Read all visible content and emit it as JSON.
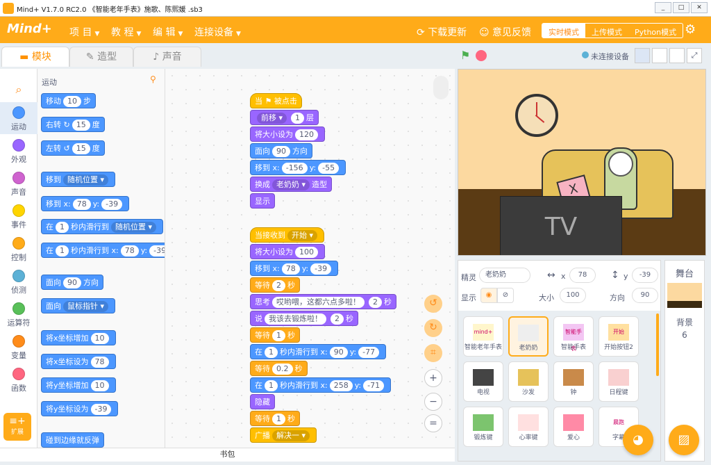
{
  "window": {
    "title": "Mind+ V1.7.0 RC2.0   《智能老年手表》施歌、陈熙媛 .sb3",
    "controls": [
      "_",
      "□",
      "✕"
    ]
  },
  "menubar": {
    "brand": "Mind+",
    "items": [
      "项 目",
      "教 程",
      "编 辑",
      "连接设备"
    ],
    "download": "下载更新",
    "feedback": "意见反馈",
    "modes": [
      "实时模式",
      "上传模式",
      "Python模式"
    ]
  },
  "tabs": {
    "blocks": "模块",
    "costumes": "造型",
    "sounds": "声音"
  },
  "categories": [
    {
      "label": "运动",
      "color": "#4c97ff"
    },
    {
      "label": "外观",
      "color": "#9966ff"
    },
    {
      "label": "声音",
      "color": "#cf63cf"
    },
    {
      "label": "事件",
      "color": "#ffd500"
    },
    {
      "label": "控制",
      "color": "#ffab19"
    },
    {
      "label": "侦测",
      "color": "#5cb1d6"
    },
    {
      "label": "运算符",
      "color": "#59c059"
    },
    {
      "label": "变量",
      "color": "#ff8c1a"
    },
    {
      "label": "函数",
      "color": "#ff6680"
    }
  ],
  "extension": "扩展",
  "palette": {
    "section": "运动",
    "move": {
      "a": "移动",
      "v": "10",
      "b": "步"
    },
    "turn_right": {
      "a": "右转 ↻",
      "v": "15",
      "b": "度"
    },
    "turn_left": {
      "a": "左转 ↺",
      "v": "15",
      "b": "度"
    },
    "goto": {
      "a": "移到",
      "dd": "随机位置 ▾"
    },
    "goto_xy": {
      "a": "移到 x:",
      "x": "78",
      "b": "y:",
      "y": "-39"
    },
    "glide": {
      "a": "在",
      "v": "1",
      "b": "秒内滑行到",
      "dd": "随机位置 ▾"
    },
    "glide_xy": {
      "a": "在",
      "v": "1",
      "b": "秒内滑行到 x:",
      "x": "78",
      "c": "y:",
      "y": "-39"
    },
    "point": {
      "a": "面向",
      "v": "90",
      "b": "方向"
    },
    "point_to": {
      "a": "面向",
      "dd": "鼠标指针 ▾"
    },
    "change_x": {
      "a": "将x坐标增加",
      "v": "10"
    },
    "set_x": {
      "a": "将x坐标设为",
      "v": "78"
    },
    "change_y": {
      "a": "将y坐标增加",
      "v": "10"
    },
    "set_y": {
      "a": "将y坐标设为",
      "v": "-39"
    },
    "bounce": "碰到边缘就反弹"
  },
  "script1": {
    "hat": "当 ⚑ 被点击",
    "layer": {
      "dd": "前移 ▾",
      "v": "1",
      "b": "层"
    },
    "size": {
      "a": "将大小设为",
      "v": "120"
    },
    "dir": {
      "a": "面向",
      "v": "90",
      "b": "方向"
    },
    "pos": {
      "a": "移到 x:",
      "x": "-156",
      "b": "y:",
      "y": "-55"
    },
    "costume": {
      "a": "换成",
      "dd": "老奶奶 ▾",
      "b": "造型"
    },
    "show": "显示"
  },
  "script2": {
    "hat": {
      "a": "当接收到",
      "dd": "开始 ▾"
    },
    "size": {
      "a": "将大小设为",
      "v": "100"
    },
    "pos": {
      "a": "移到 x:",
      "x": "78",
      "b": "y:",
      "y": "-39"
    },
    "wait1": {
      "a": "等待",
      "v": "2",
      "b": "秒"
    },
    "think": {
      "a": "思考",
      "t": "哎哟喂，这都六点多啦！",
      "v": "2",
      "b": "秒"
    },
    "say": {
      "a": "说",
      "t": "我该去锻炼啦！",
      "v": "2",
      "b": "秒"
    },
    "wait2": {
      "a": "等待",
      "v": "1",
      "b": "秒"
    },
    "glide1": {
      "a": "在",
      "v": "1",
      "b": "秒内滑行到 x:",
      "x": "90",
      "c": "y:",
      "y": "-77"
    },
    "wait3": {
      "a": "等待",
      "v": "0.2",
      "b": "秒"
    },
    "glide2": {
      "a": "在",
      "v": "1",
      "b": "秒内滑行到 x:",
      "x": "258",
      "c": "y:",
      "y": "-71"
    },
    "hide": "隐藏",
    "wait4": {
      "a": "等待",
      "v": "1",
      "b": "秒"
    },
    "broadcast": {
      "a": "广播",
      "dd": "解决一 ▾"
    }
  },
  "bookbar": "书包",
  "stagehead": {
    "status": "未连接设备"
  },
  "stage": {
    "tv_text": "TV"
  },
  "sprite": {
    "label": "精灵",
    "name": "老奶奶",
    "x": "78",
    "y": "-39",
    "show": "显示",
    "size_label": "大小",
    "size": "100",
    "dir_label": "方向",
    "dir": "90",
    "x_label": "x",
    "y_label": "y"
  },
  "sprites": [
    {
      "name": "智能老年手表",
      "tag": "mind+"
    },
    {
      "name": "老奶奶",
      "tag": ""
    },
    {
      "name": "智能手表",
      "tag": "智能手表"
    },
    {
      "name": "开始按钮2",
      "tag": "开始"
    },
    {
      "name": "电视",
      "tag": ""
    },
    {
      "name": "沙发",
      "tag": ""
    },
    {
      "name": "钟",
      "tag": ""
    },
    {
      "name": "日程键",
      "tag": ""
    },
    {
      "name": "锻炼键",
      "tag": ""
    },
    {
      "name": "心率键",
      "tag": ""
    },
    {
      "name": "爱心",
      "tag": ""
    },
    {
      "name": "字幕",
      "tag": "晨跑"
    }
  ],
  "backdrop": {
    "title": "舞台",
    "label": "背景",
    "count": "6"
  }
}
